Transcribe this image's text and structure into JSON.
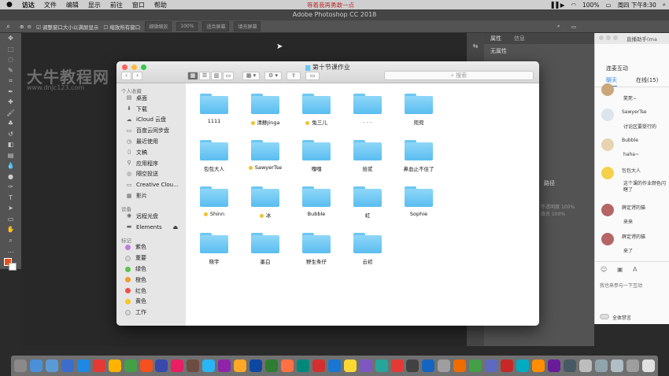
{
  "menubar": {
    "apple": "",
    "items": [
      "访达",
      "文件",
      "编辑",
      "显示",
      "前往",
      "窗口",
      "帮助"
    ],
    "center": "等着我再勇敢一点",
    "battery": "100%",
    "clock": "周四 下午8:30"
  },
  "photoshop": {
    "title": "Adobe Photoshop CC 2018",
    "options": [
      "调整窗口大小以满屏显示",
      "缩放所有窗口",
      "细微缩放",
      "100%",
      "适合屏幕",
      "填充屏幕"
    ],
    "panel_tabs": [
      "属性",
      "信息"
    ],
    "no_props": "无属性",
    "path_tab": "路径",
    "layer_fields": [
      "不透明度",
      "100%",
      "填充",
      "100%"
    ]
  },
  "watermark": {
    "title": "大牛教程网",
    "url": "www.dnjc123.com"
  },
  "finder": {
    "title": "第十节课作业",
    "search_placeholder": "搜索",
    "sidebar": {
      "favorites_header": "个人收藏",
      "favorites": [
        {
          "label": "桌面",
          "icon": "desktop-icon"
        },
        {
          "label": "下载",
          "icon": "download-icon"
        },
        {
          "label": "iCloud 云盘",
          "icon": "cloud-icon"
        },
        {
          "label": "百度云同步盘",
          "icon": "folder-icon"
        },
        {
          "label": "最近使用",
          "icon": "clock-icon"
        },
        {
          "label": "文稿",
          "icon": "document-icon"
        },
        {
          "label": "应用程序",
          "icon": "apps-icon"
        },
        {
          "label": "隔空投送",
          "icon": "airdrop-icon"
        },
        {
          "label": "Creative Clou...",
          "icon": "folder-icon"
        },
        {
          "label": "影片",
          "icon": "film-icon"
        }
      ],
      "devices_header": "设备",
      "devices": [
        {
          "label": "远程光盘",
          "icon": "disc-icon"
        },
        {
          "label": "Elements",
          "icon": "disk-icon",
          "eject": "⏏"
        }
      ],
      "tags_header": "标记",
      "tags": [
        {
          "label": "紫色",
          "color": "#bf7be0"
        },
        {
          "label": "重要",
          "color": "#d8d8d8"
        },
        {
          "label": "绿色",
          "color": "#5cc24f"
        },
        {
          "label": "橙色",
          "color": "#f39a2b"
        },
        {
          "label": "红色",
          "color": "#f0504a"
        },
        {
          "label": "黄色",
          "color": "#f5c522"
        },
        {
          "label": "工作",
          "color": "#d8d8d8"
        }
      ]
    },
    "folders": [
      {
        "label": "1111",
        "tag": false
      },
      {
        "label": "清静Jinga",
        "tag": true
      },
      {
        "label": "兔三儿",
        "tag": true
      },
      {
        "label": ". . .",
        "tag": false
      },
      {
        "label": "兜兜",
        "tag": false
      },
      {
        "label": "包包大人",
        "tag": false
      },
      {
        "label": "SawyerTse",
        "tag": true
      },
      {
        "label": "嘎嘎",
        "tag": false
      },
      {
        "label": "拾贰",
        "tag": false
      },
      {
        "label": "鼻血止不住了",
        "tag": false
      },
      {
        "label": "Shinn",
        "tag": true
      },
      {
        "label": "冰",
        "tag": true
      },
      {
        "label": "Bubble",
        "tag": false
      },
      {
        "label": "虹",
        "tag": false
      },
      {
        "label": "Sophie",
        "tag": false
      },
      {
        "label": "晓宇",
        "tag": false
      },
      {
        "label": "墨白",
        "tag": false
      },
      {
        "label": "野生条仔",
        "tag": false
      },
      {
        "label": "云初",
        "tag": false
      }
    ]
  },
  "chat": {
    "title": "直播助手(ma",
    "section": "连麦互动",
    "tabs": [
      "聊天",
      "在线(15)"
    ],
    "messages": [
      {
        "name": "",
        "text": "笑死~"
      },
      {
        "name": "SawyerTse",
        "text": "讨论区要挺行的"
      },
      {
        "name": "Bubble",
        "text": "haha~"
      },
      {
        "name": "包包大人",
        "text": "这个课的作业颜色闪瞎了"
      },
      {
        "name": "薛定谔的猫",
        "text": "来来"
      },
      {
        "name": "薛定谔的猫",
        "text": "来了"
      }
    ],
    "input_placeholder": "我也来参与一下互动",
    "mute_all": "全体禁言"
  },
  "brand_colors": {
    "folder": "#6cc7f2",
    "ps_bg": "#535353",
    "tag_yellow": "#f2c12e"
  }
}
